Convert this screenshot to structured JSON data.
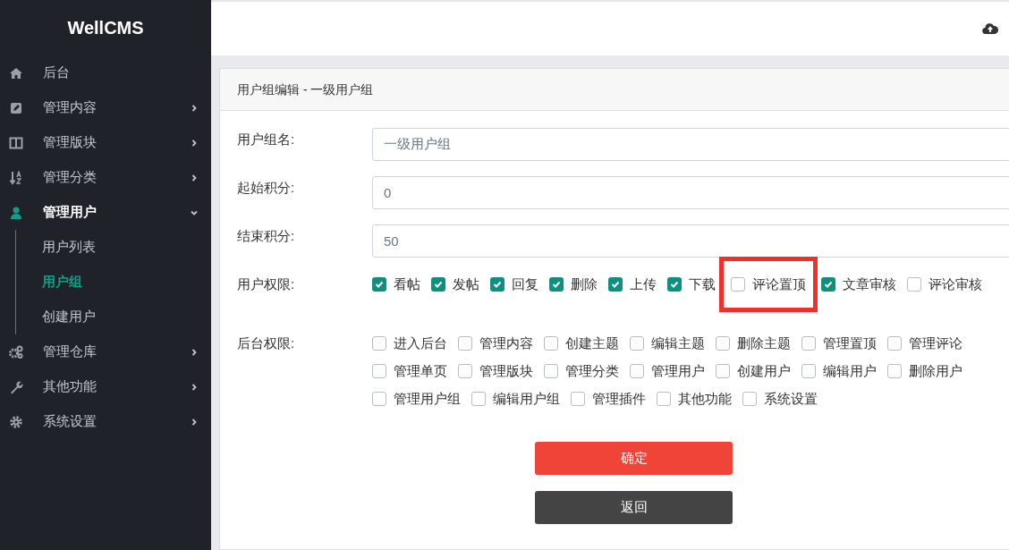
{
  "brand": "WellCMS",
  "sidebar": {
    "items": [
      {
        "label": "后台"
      },
      {
        "label": "管理内容",
        "expanded": false
      },
      {
        "label": "管理版块",
        "expanded": false
      },
      {
        "label": "管理分类",
        "expanded": false
      },
      {
        "label": "管理用户",
        "expanded": true,
        "children": [
          {
            "label": "用户列表",
            "selected": false
          },
          {
            "label": "用户组",
            "selected": true
          },
          {
            "label": "创建用户",
            "selected": false
          }
        ]
      },
      {
        "label": "管理仓库",
        "expanded": false
      },
      {
        "label": "其他功能",
        "expanded": false
      },
      {
        "label": "系统设置",
        "expanded": false
      }
    ]
  },
  "card": {
    "title": "用户组编辑 - 一级用户组",
    "fields": [
      {
        "label": "用户组名:",
        "value": "一级用户组"
      },
      {
        "label": "起始积分:",
        "value": "0"
      },
      {
        "label": "结束积分:",
        "value": "50"
      }
    ],
    "permission_groups": [
      {
        "label": "用户权限:",
        "options": [
          {
            "label": "看帖",
            "checked": true
          },
          {
            "label": "发帖",
            "checked": true
          },
          {
            "label": "回复",
            "checked": true
          },
          {
            "label": "删除",
            "checked": true
          },
          {
            "label": "上传",
            "checked": true
          },
          {
            "label": "下载",
            "checked": true
          },
          {
            "label": "评论置顶",
            "checked": false,
            "highlighted": true
          },
          {
            "label": "文章审核",
            "checked": true
          },
          {
            "label": "评论审核",
            "checked": false
          }
        ]
      },
      {
        "label": "后台权限:",
        "options": [
          {
            "label": "进入后台",
            "checked": false
          },
          {
            "label": "管理内容",
            "checked": false
          },
          {
            "label": "创建主题",
            "checked": false
          },
          {
            "label": "编辑主题",
            "checked": false
          },
          {
            "label": "删除主题",
            "checked": false
          },
          {
            "label": "管理置顶",
            "checked": false
          },
          {
            "label": "管理评论",
            "checked": false
          },
          {
            "label": "管理单页",
            "checked": false
          },
          {
            "label": "管理版块",
            "checked": false
          },
          {
            "label": "管理分类",
            "checked": false
          },
          {
            "label": "管理用户",
            "checked": false
          },
          {
            "label": "创建用户",
            "checked": false
          },
          {
            "label": "编辑用户",
            "checked": false
          },
          {
            "label": "删除用户",
            "checked": false
          },
          {
            "label": "管理用户组",
            "checked": false
          },
          {
            "label": "编辑用户组",
            "checked": false
          },
          {
            "label": "管理插件",
            "checked": false
          },
          {
            "label": "其他功能",
            "checked": false
          },
          {
            "label": "系统设置",
            "checked": false
          }
        ]
      }
    ],
    "buttons": [
      {
        "label": "确定",
        "kind": "primary"
      },
      {
        "label": "返回",
        "kind": "secondary"
      }
    ]
  }
}
